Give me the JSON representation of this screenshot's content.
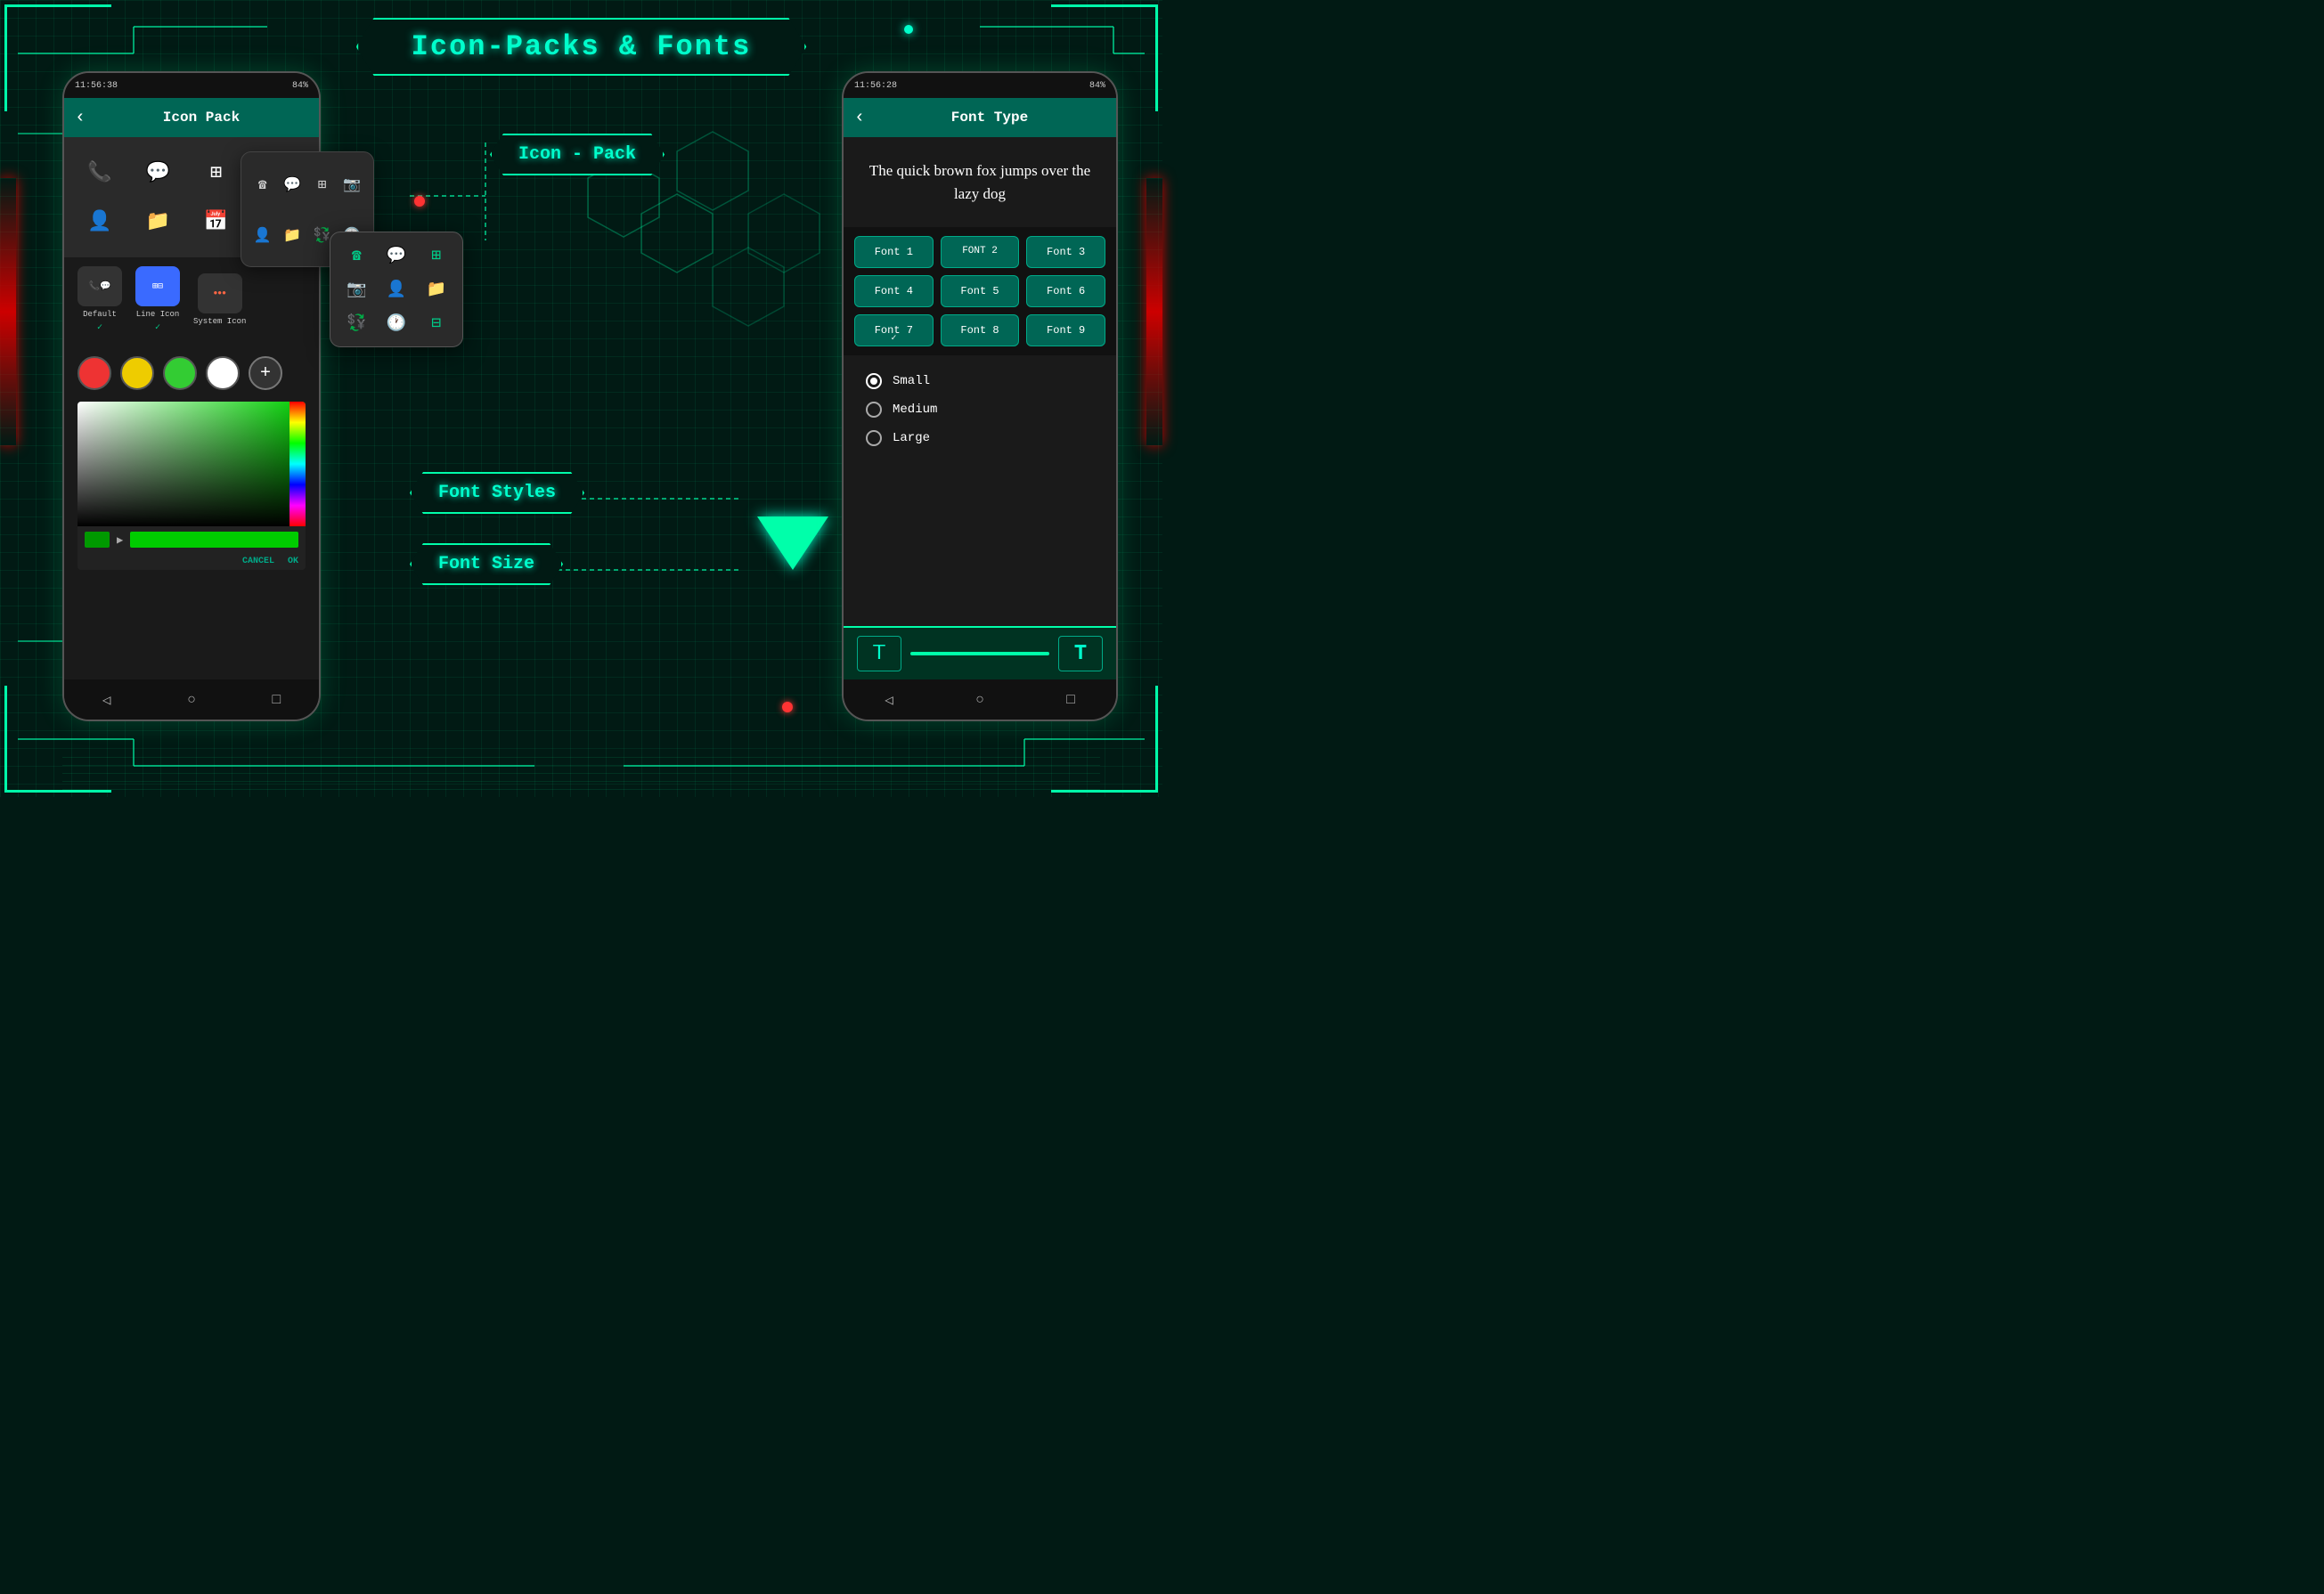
{
  "app": {
    "title": "Icon-Packs & Fonts",
    "bg_color": "#011a14",
    "accent_color": "#00ffcc",
    "accent_secondary": "#00aa88"
  },
  "phone_left": {
    "status_bar": {
      "time": "11:56:38",
      "battery": "84%"
    },
    "header": {
      "back_label": "‹",
      "title": "Icon Pack"
    },
    "icon_styles": {
      "default_label": "Default",
      "line_label": "Line Icon",
      "system_label": "System Icon"
    },
    "color_picker": {
      "cancel_label": "CANCEL",
      "ok_label": "OK"
    }
  },
  "phone_right": {
    "status_bar": {
      "time": "11:56:28",
      "battery": "84%"
    },
    "header": {
      "back_label": "‹",
      "title": "Font Type"
    },
    "preview_text": "The quick brown fox jumps over the lazy dog",
    "fonts": [
      {
        "label": "Font 1",
        "id": "font1"
      },
      {
        "label": "FONT 2",
        "id": "font2",
        "special": true
      },
      {
        "label": "Font 3",
        "id": "font3"
      },
      {
        "label": "Font 4",
        "id": "font4"
      },
      {
        "label": "Font 5",
        "id": "font5"
      },
      {
        "label": "Font 6",
        "id": "font6"
      },
      {
        "label": "Font 7",
        "id": "font7",
        "selected": true
      },
      {
        "label": "Font 8",
        "id": "font8"
      },
      {
        "label": "Font 9",
        "id": "font9"
      }
    ],
    "size_options": [
      {
        "label": "Small",
        "selected": true
      },
      {
        "label": "Medium",
        "selected": false
      },
      {
        "label": "Large",
        "selected": false
      }
    ]
  },
  "labels": {
    "icon_pack": "Icon - Pack",
    "font_styles": "Font Styles",
    "font_size": "Font Size"
  },
  "annotations": {
    "font_top_right": "Font",
    "font_mid_right": "Font",
    "font_top2_right": "Font",
    "icon_pack_left": "Icon Pack",
    "system_icon": "System Icon"
  }
}
